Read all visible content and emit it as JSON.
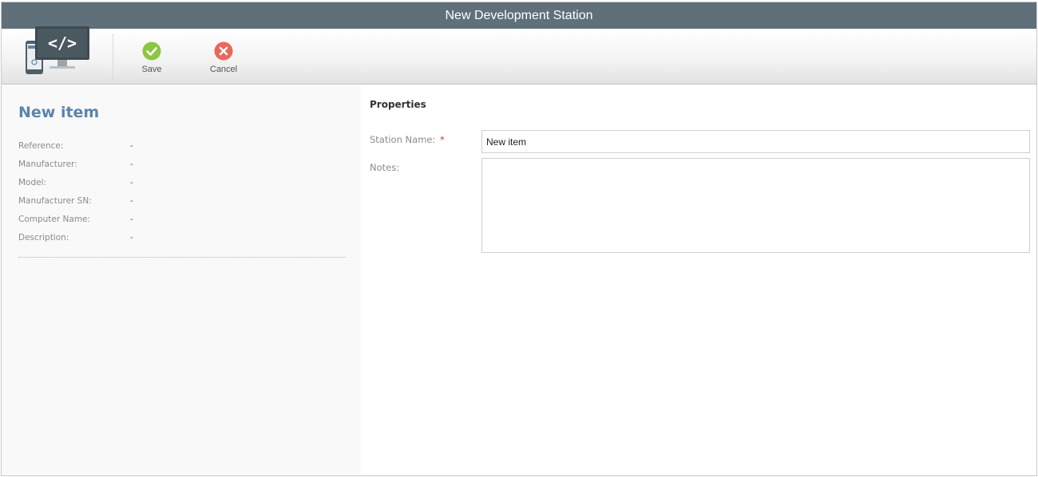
{
  "window": {
    "title": "New Development Station"
  },
  "toolbar": {
    "app_icon": "development-station-icon",
    "save_label": "Save",
    "save_icon": "checkmark-circle-icon",
    "cancel_label": "Cancel",
    "cancel_icon": "close-circle-icon"
  },
  "summary": {
    "title": "New item",
    "rows": [
      {
        "label": "Reference:",
        "value": "-"
      },
      {
        "label": "Manufacturer:",
        "value": "-"
      },
      {
        "label": "Model:",
        "value": "-"
      },
      {
        "label": "Manufacturer SN:",
        "value": "-"
      },
      {
        "label": "Computer Name:",
        "value": "-"
      },
      {
        "label": "Description:",
        "value": "-"
      }
    ]
  },
  "properties": {
    "section_title": "Properties",
    "station_name_label": "Station Name:",
    "required_marker": "*",
    "station_name_value": "New item",
    "notes_label": "Notes:",
    "notes_value": ""
  },
  "colors": {
    "titlebar": "#5f707b",
    "item_title": "#5b85aa",
    "save_green": "#8dc63f",
    "cancel_red": "#e8685a",
    "required": "#c0392b"
  }
}
